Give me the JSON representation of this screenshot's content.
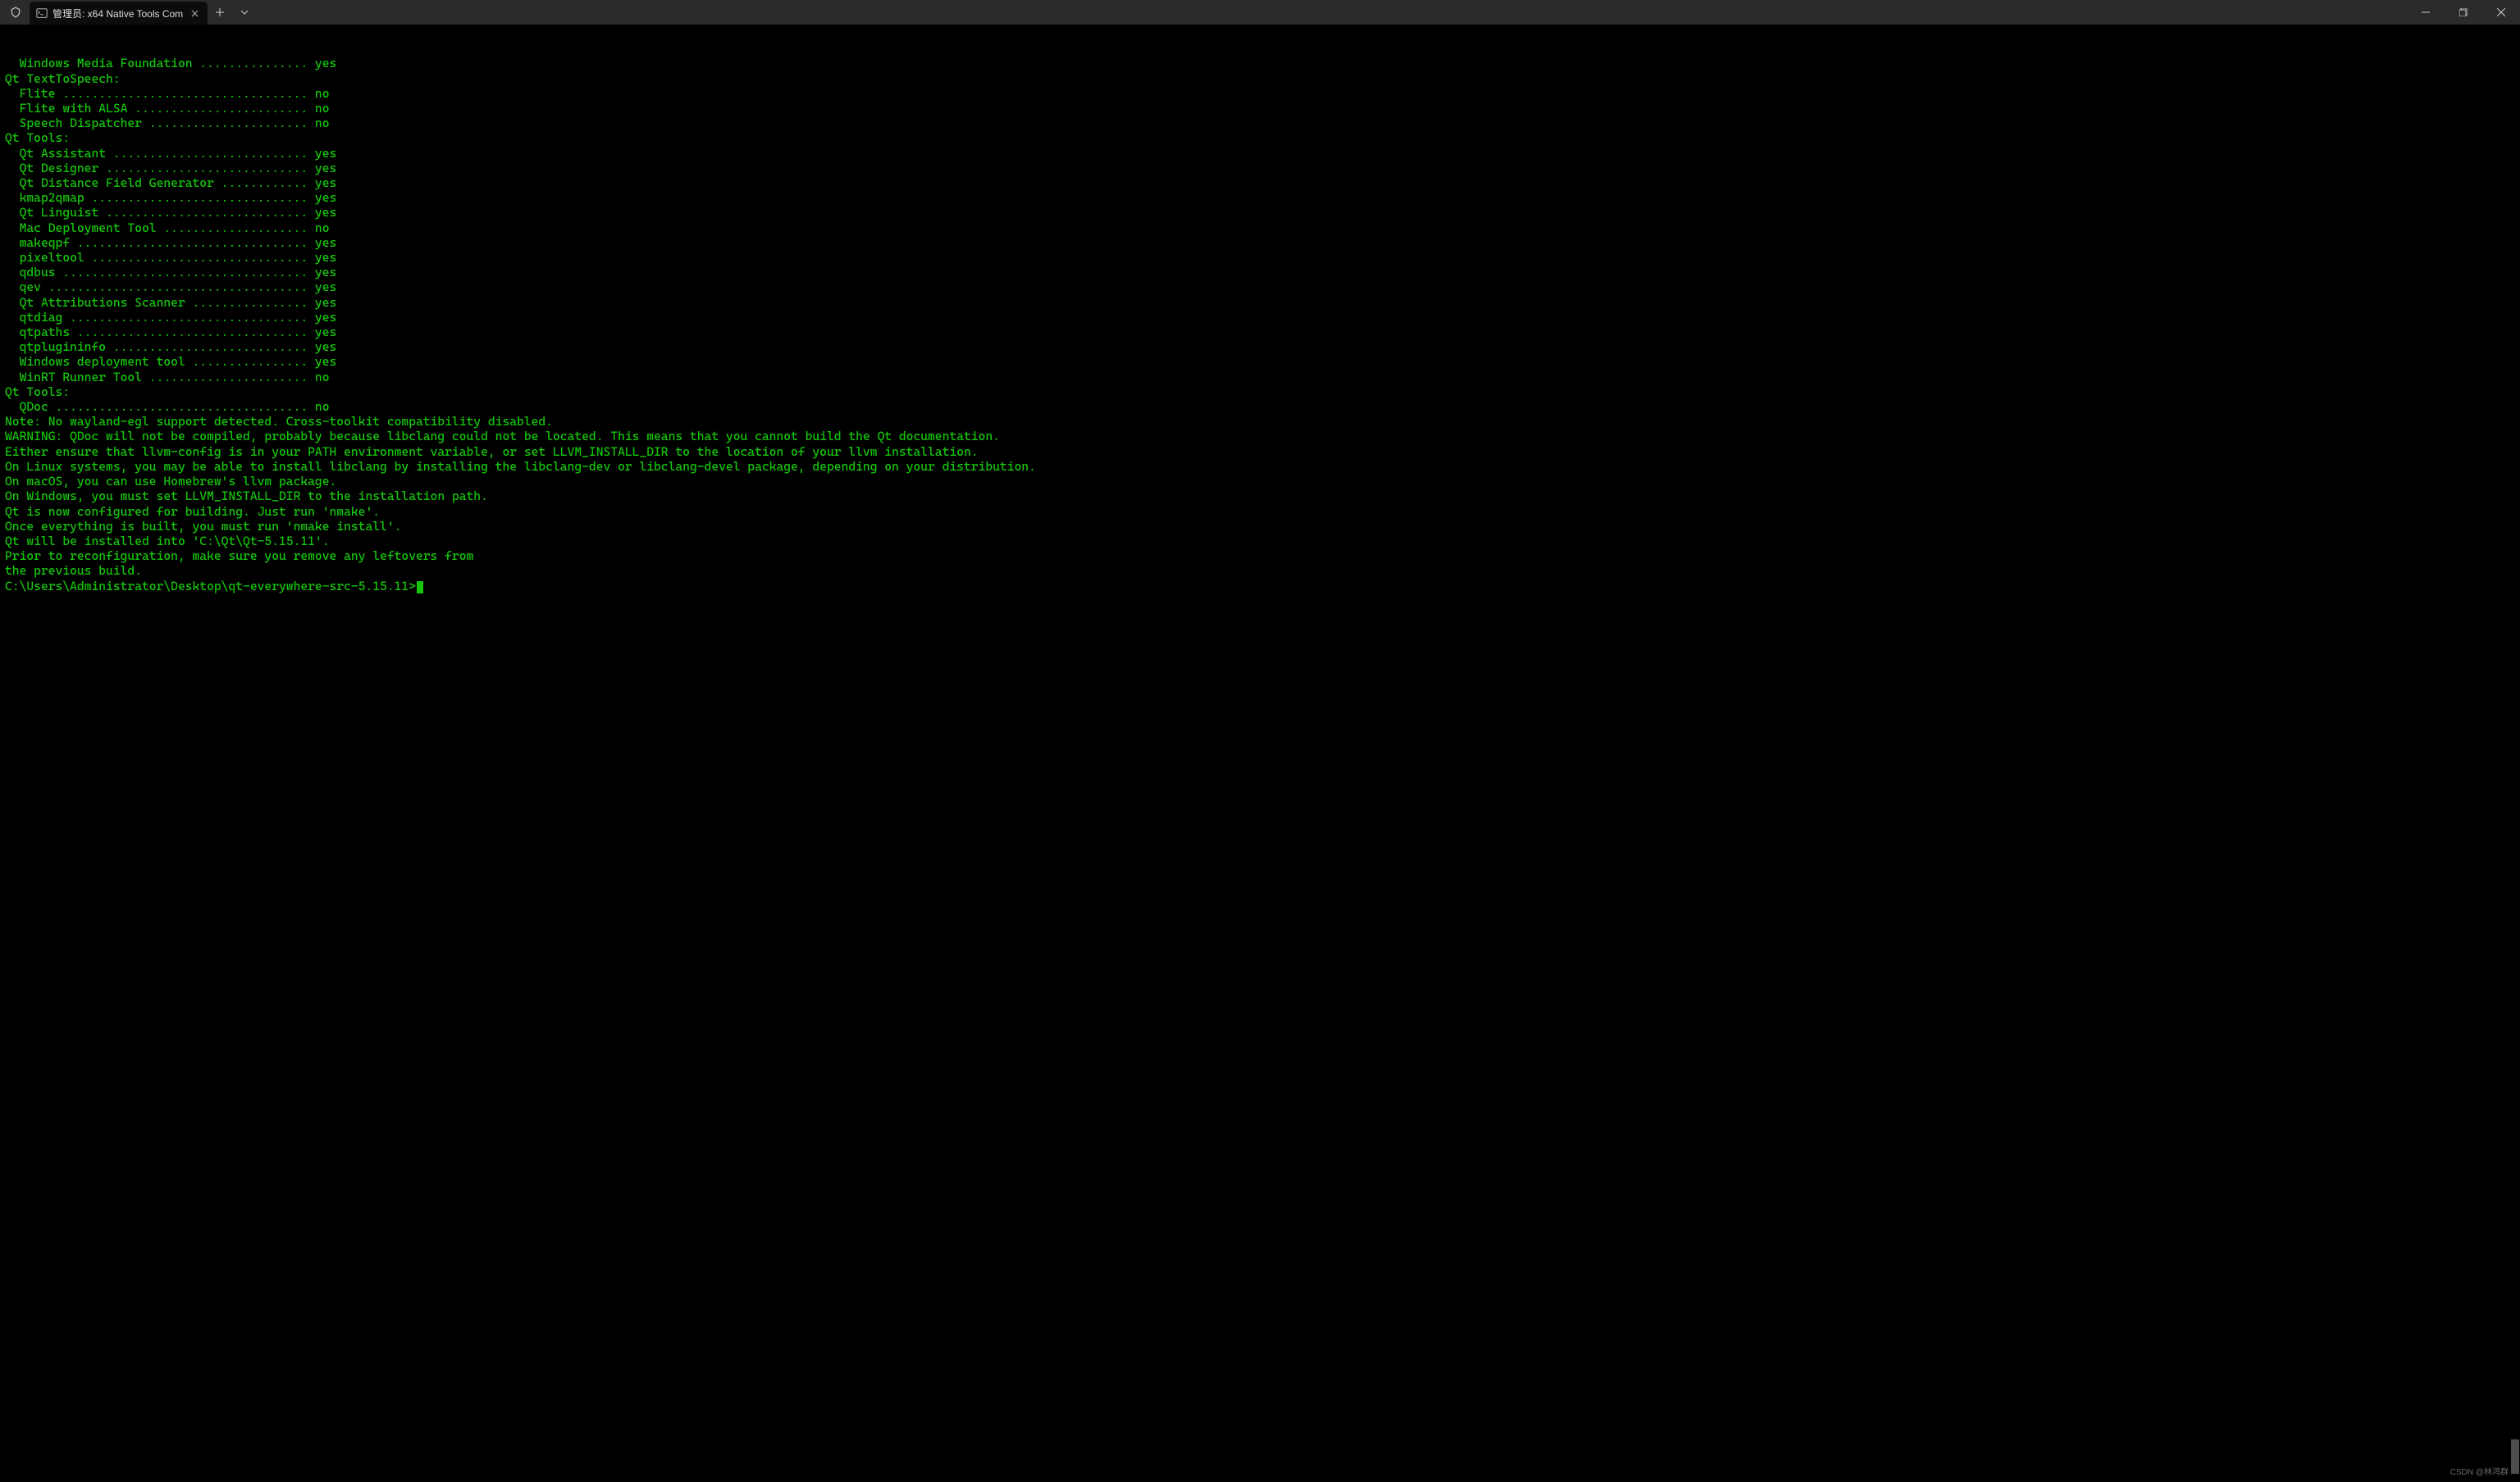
{
  "window": {
    "tab_title": "管理员: x64 Native Tools Com"
  },
  "colors": {
    "fg": "#16c60c",
    "bg": "#000000"
  },
  "terminal_lines": [
    "  Windows Media Foundation ............... yes",
    "Qt TextToSpeech:",
    "  Flite .................................. no",
    "  Flite with ALSA ........................ no",
    "  Speech Dispatcher ...................... no",
    "Qt Tools:",
    "  Qt Assistant ........................... yes",
    "  Qt Designer ............................ yes",
    "  Qt Distance Field Generator ............ yes",
    "  kmap2qmap .............................. yes",
    "  Qt Linguist ............................ yes",
    "  Mac Deployment Tool .................... no",
    "  makeqpf ................................ yes",
    "  pixeltool .............................. yes",
    "  qdbus .................................. yes",
    "  qev .................................... yes",
    "  Qt Attributions Scanner ................ yes",
    "  qtdiag ................................. yes",
    "  qtpaths ................................ yes",
    "  qtplugininfo ........................... yes",
    "  Windows deployment tool ................ yes",
    "  WinRT Runner Tool ...................... no",
    "Qt Tools:",
    "  QDoc ................................... no",
    "",
    "Note: No wayland-egl support detected. Cross-toolkit compatibility disabled.",
    "",
    "WARNING: QDoc will not be compiled, probably because libclang could not be located. This means that you cannot build the Qt documentation.",
    "",
    "Either ensure that llvm-config is in your PATH environment variable, or set LLVM_INSTALL_DIR to the location of your llvm installation.",
    "On Linux systems, you may be able to install libclang by installing the libclang-dev or libclang-devel package, depending on your distribution.",
    "On macOS, you can use Homebrew's llvm package.",
    "On Windows, you must set LLVM_INSTALL_DIR to the installation path.",
    "",
    "Qt is now configured for building. Just run 'nmake'.",
    "Once everything is built, you must run 'nmake install'.",
    "Qt will be installed into 'C:\\Qt\\Qt-5.15.11'.",
    "",
    "Prior to reconfiguration, make sure you remove any leftovers from",
    "the previous build.",
    "",
    ""
  ],
  "prompt": "C:\\Users\\Administrator\\Desktop\\qt-everywhere-src-5.15.11>",
  "watermark": "CSDN @林鸿群"
}
